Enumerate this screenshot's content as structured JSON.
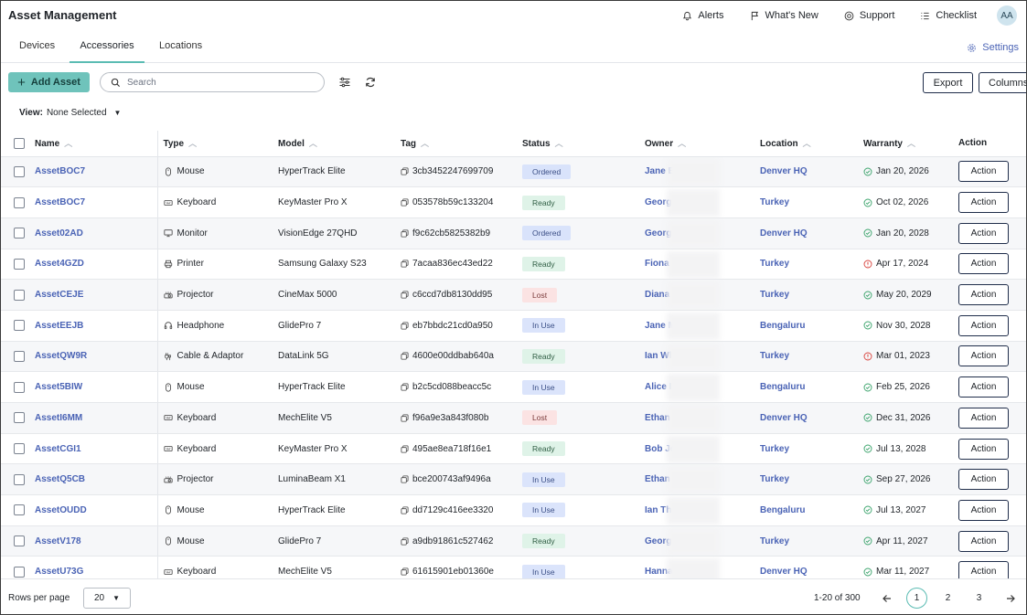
{
  "app": {
    "title": "Asset Management"
  },
  "top_nav": {
    "alerts": "Alerts",
    "whats_new": "What's New",
    "support": "Support",
    "checklist": "Checklist",
    "avatar_initials": "AA"
  },
  "tabs": [
    {
      "label": "Devices",
      "active": false
    },
    {
      "label": "Accessories",
      "active": true
    },
    {
      "label": "Locations",
      "active": false
    }
  ],
  "settings_label": "Settings",
  "toolbar": {
    "add_label": "Add Asset",
    "search_placeholder": "Search",
    "export_label": "Export",
    "columns_label": "Columns"
  },
  "view": {
    "label": "View:",
    "value": "None Selected"
  },
  "table": {
    "headers": {
      "name": "Name",
      "type": "Type",
      "model": "Model",
      "tag": "Tag",
      "status": "Status",
      "owner": "Owner",
      "location": "Location",
      "warranty": "Warranty",
      "action": "Action"
    },
    "rows": [
      {
        "name": "AssetBOC7",
        "type": "Mouse",
        "type_icon": "mouse-icon",
        "model": "HyperTrack Elite",
        "tag": "3cb3452247699709",
        "status": "Ordered",
        "owner": "Jane E",
        "location": "Denver HQ",
        "warranty": "Jan 20, 2026",
        "warranty_state": "ok",
        "action": "Action"
      },
      {
        "name": "AssetBOC7",
        "type": "Keyboard",
        "type_icon": "keyboard-icon",
        "model": "KeyMaster Pro X",
        "tag": "053578b59c133204",
        "status": "Ready",
        "owner": "Georg",
        "location": "Turkey",
        "warranty": "Oct 02, 2026",
        "warranty_state": "ok",
        "action": "Action"
      },
      {
        "name": "Asset02AD",
        "type": "Monitor",
        "type_icon": "monitor-icon",
        "model": "VisionEdge 27QHD",
        "tag": "f9c62cb5825382b9",
        "status": "Ordered",
        "owner": "Georg",
        "location": "Denver HQ",
        "warranty": "Jan 20, 2028",
        "warranty_state": "ok",
        "action": "Action"
      },
      {
        "name": "Asset4GZD",
        "type": "Printer",
        "type_icon": "printer-icon",
        "model": "Samsung Galaxy S23",
        "tag": "7acaa836ec43ed22",
        "status": "Ready",
        "owner": "Fiona",
        "location": "Turkey",
        "warranty": "Apr 17, 2024",
        "warranty_state": "expired",
        "action": "Action"
      },
      {
        "name": "AssetCEJE",
        "type": "Projector",
        "type_icon": "projector-icon",
        "model": "CineMax 5000",
        "tag": "c6ccd7db8130dd95",
        "status": "Lost",
        "owner": "Diana",
        "location": "Turkey",
        "warranty": "May 20, 2029",
        "warranty_state": "ok",
        "action": "Action"
      },
      {
        "name": "AssetEEJB",
        "type": "Headphone",
        "type_icon": "headphone-icon",
        "model": "GlidePro 7",
        "tag": "eb7bbdc21cd0a950",
        "status": "In Use",
        "owner": "Jane M",
        "location": "Bengaluru",
        "warranty": "Nov 30, 2028",
        "warranty_state": "ok",
        "action": "Action"
      },
      {
        "name": "AssetQW9R",
        "type": "Cable & Adaptor",
        "type_icon": "cable-icon",
        "model": "DataLink 5G",
        "tag": "4600e00ddbab640a",
        "status": "Ready",
        "owner": "Ian Wl",
        "location": "Turkey",
        "warranty": "Mar 01, 2023",
        "warranty_state": "expired",
        "action": "Action"
      },
      {
        "name": "Asset5BIW",
        "type": "Mouse",
        "type_icon": "mouse-icon",
        "model": "HyperTrack Elite",
        "tag": "b2c5cd088beacc5c",
        "status": "In Use",
        "owner": "Alice I",
        "location": "Bengaluru",
        "warranty": "Feb 25, 2026",
        "warranty_state": "ok",
        "action": "Action"
      },
      {
        "name": "AssetI6MM",
        "type": "Keyboard",
        "type_icon": "keyboard-icon",
        "model": "MechElite V5",
        "tag": "f96a9e3a843f080b",
        "status": "Lost",
        "owner": "Ethan",
        "location": "Denver HQ",
        "warranty": "Dec 31, 2026",
        "warranty_state": "ok",
        "action": "Action"
      },
      {
        "name": "AssetCGI1",
        "type": "Keyboard",
        "type_icon": "keyboard-icon",
        "model": "KeyMaster Pro X",
        "tag": "495ae8ea718f16e1",
        "status": "Ready",
        "owner": "Bob Jo",
        "location": "Turkey",
        "warranty": "Jul 13, 2028",
        "warranty_state": "ok",
        "action": "Action"
      },
      {
        "name": "AssetQ5CB",
        "type": "Projector",
        "type_icon": "projector-icon",
        "model": "LuminaBeam X1",
        "tag": "bce200743af9496a",
        "status": "In Use",
        "owner": "Ethan",
        "location": "Turkey",
        "warranty": "Sep 27, 2026",
        "warranty_state": "ok",
        "action": "Action"
      },
      {
        "name": "AssetOUDD",
        "type": "Mouse",
        "type_icon": "mouse-icon",
        "model": "HyperTrack Elite",
        "tag": "dd7129c416ee3320",
        "status": "In Use",
        "owner": "Ian Th",
        "location": "Bengaluru",
        "warranty": "Jul 13, 2027",
        "warranty_state": "ok",
        "action": "Action"
      },
      {
        "name": "AssetV178",
        "type": "Mouse",
        "type_icon": "mouse-icon",
        "model": "GlidePro 7",
        "tag": "a9db91861c527462",
        "status": "Ready",
        "owner": "Georg",
        "location": "Turkey",
        "warranty": "Apr 11, 2027",
        "warranty_state": "ok",
        "action": "Action"
      },
      {
        "name": "AssetU73G",
        "type": "Keyboard",
        "type_icon": "keyboard-icon",
        "model": "MechElite V5",
        "tag": "61615901eb01360e",
        "status": "In Use",
        "owner": "Hanna",
        "location": "Denver HQ",
        "warranty": "Mar 11, 2027",
        "warranty_state": "ok",
        "action": "Action"
      }
    ]
  },
  "status_colors": {
    "Ordered": {
      "bg": "#d9e3fb",
      "fg": "#3b4f86"
    },
    "Ready": {
      "bg": "#dff3e8",
      "fg": "#2f5e44"
    },
    "Lost": {
      "bg": "#fbe3e3",
      "fg": "#7a3a3a"
    },
    "In Use": {
      "bg": "#dbe4fb",
      "fg": "#3b4f86"
    }
  },
  "warranty_colors": {
    "ok": "#3aa36b",
    "expired": "#d9453f"
  },
  "footer": {
    "rows_per_page_label": "Rows per page",
    "rows_per_page_value": "20",
    "range_text": "1-20 of 300",
    "pages": [
      "1",
      "2",
      "3"
    ],
    "current_page": "1"
  }
}
